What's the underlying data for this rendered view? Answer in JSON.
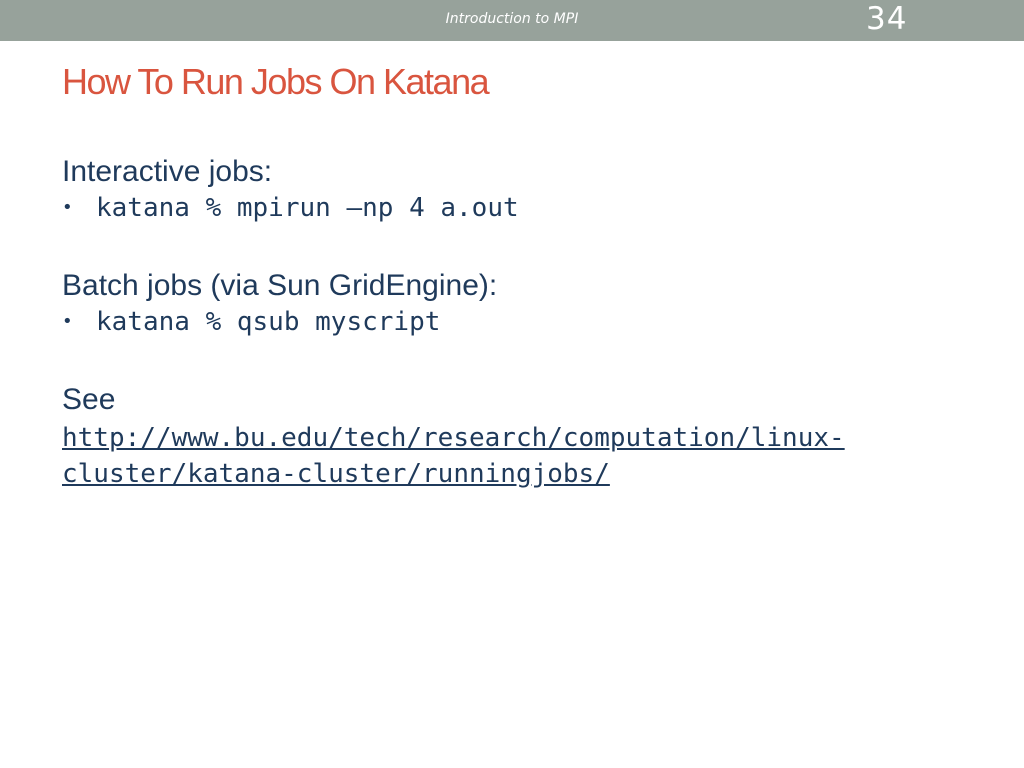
{
  "header": {
    "title": "Introduction to MPI",
    "page_number": "34"
  },
  "slide": {
    "title": "How To Run Jobs On Katana",
    "sections": [
      {
        "heading": "Interactive jobs:",
        "bullet": "katana % mpirun –np 4 a.out"
      },
      {
        "heading": "Batch jobs (via Sun GridEngine):",
        "bullet": "katana % qsub myscript"
      }
    ],
    "see_label": "See",
    "link_line1": "http://www.bu.edu/tech/research/computation/linux-",
    "link_line2": "cluster/katana-cluster/runningjobs/"
  },
  "colors": {
    "header_bar": "#97a29b",
    "title": "#d9553f",
    "body_text": "#1f3a5b"
  }
}
